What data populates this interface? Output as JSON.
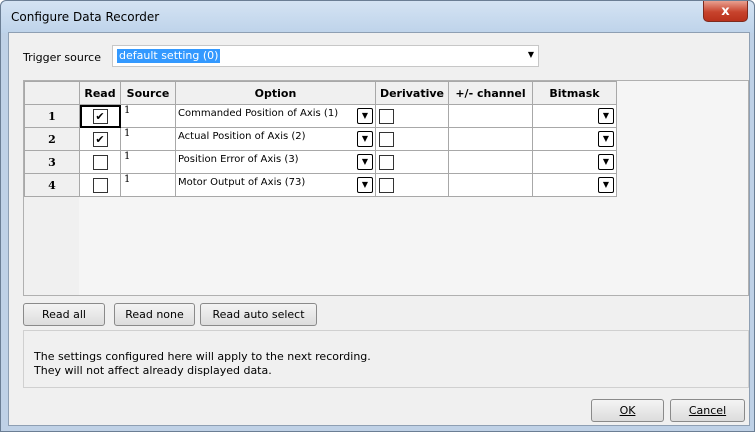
{
  "window": {
    "title": "Configure Data Recorder",
    "close_label": "x"
  },
  "trigger": {
    "label": "Trigger source",
    "value": "default setting (0)",
    "arrow": "▼"
  },
  "grid": {
    "headers": [
      "",
      "Read",
      "Source",
      "Option",
      "Derivative",
      "+/- channel",
      "Bitmask"
    ],
    "rows": [
      {
        "num": "1",
        "read": true,
        "source": "1",
        "option": "Commanded Position of Axis (1)",
        "derivative": false
      },
      {
        "num": "2",
        "read": true,
        "source": "1",
        "option": "Actual Position of Axis (2)",
        "derivative": false
      },
      {
        "num": "3",
        "read": false,
        "source": "1",
        "option": "Position Error of Axis (3)",
        "derivative": false
      },
      {
        "num": "4",
        "read": false,
        "source": "1",
        "option": "Motor Output of Axis (73)",
        "derivative": false
      }
    ],
    "check_mark": "✔",
    "dropdown_arrow": "▼"
  },
  "buttons": {
    "read_all": "Read all",
    "read_none": "Read none",
    "read_auto": "Read auto select"
  },
  "info": {
    "line1": "The settings configured here will apply to the next recording.",
    "line2": "They will not affect already displayed data."
  },
  "footer": {
    "ok": "OK",
    "cancel": "Cancel"
  },
  "colors": {
    "selection": "#3399ff",
    "close_button": "#c7432d",
    "title_bar": "#bed3ea"
  }
}
